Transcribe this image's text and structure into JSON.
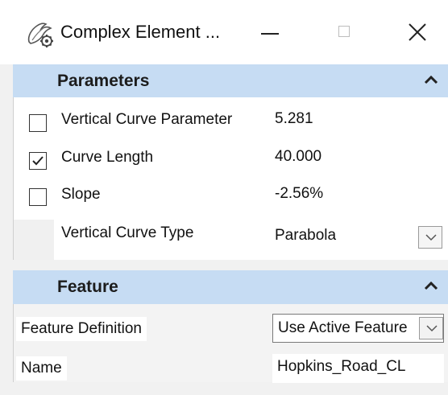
{
  "window": {
    "title": "Complex Element ...",
    "icon": "complex-element-gear-icon"
  },
  "parameters": {
    "title": "Parameters",
    "rows": [
      {
        "label": "Vertical Curve Parameter",
        "value": "5.281",
        "checked": false
      },
      {
        "label": "Curve Length",
        "value": "40.000",
        "checked": true
      },
      {
        "label": "Slope",
        "value": "-2.56%",
        "checked": false
      },
      {
        "label": "Vertical Curve Type",
        "value": "Parabola"
      }
    ]
  },
  "feature": {
    "title": "Feature",
    "definition_label": "Feature Definition",
    "definition_value": "Use Active Feature",
    "name_label": "Name",
    "name_value": "Hopkins_Road_CL"
  },
  "colors": {
    "section_header": "#c6dcf3",
    "window_background": "#f1f1f1"
  }
}
